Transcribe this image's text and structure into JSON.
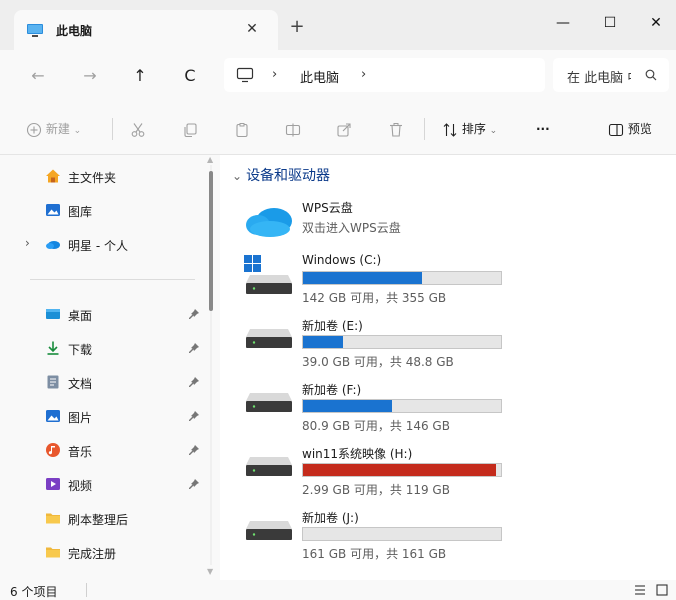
{
  "window": {
    "tab_title": "此电脑",
    "tab_close": "✕",
    "new_tab": "+",
    "minimize": "—",
    "maximize": "☐",
    "close": "✕"
  },
  "nav": {
    "back": "←",
    "forward": "→",
    "up": "↑",
    "refresh": "C",
    "separator": "›",
    "breadcrumb": "此电脑",
    "search_placeholder": "在 此电脑 中搜索"
  },
  "commandbar": {
    "new_label": "新建",
    "sort_label": "排序",
    "more_label": "···",
    "preview_label": "预览"
  },
  "sidebar": {
    "items": [
      {
        "label": "主文件夹",
        "icon": "home-icon"
      },
      {
        "label": "图库",
        "icon": "gallery-icon"
      },
      {
        "label": "明星 - 个人",
        "icon": "onedrive-cloud-icon"
      },
      {
        "label": "桌面",
        "icon": "desktop-icon",
        "pinned": true
      },
      {
        "label": "下载",
        "icon": "download-icon",
        "pinned": true
      },
      {
        "label": "文档",
        "icon": "document-icon",
        "pinned": true
      },
      {
        "label": "图片",
        "icon": "pictures-icon",
        "pinned": true
      },
      {
        "label": "音乐",
        "icon": "music-icon",
        "pinned": true
      },
      {
        "label": "视频",
        "icon": "video-icon",
        "pinned": true
      },
      {
        "label": "刷本整理后",
        "icon": "folder-icon"
      },
      {
        "label": "完成注册",
        "icon": "folder-icon"
      }
    ]
  },
  "content": {
    "group_header": "设备和驱动器",
    "wps": {
      "name": "WPS云盘",
      "subtitle": "双击进入WPS云盘"
    },
    "drives": [
      {
        "name": "Windows (C:)",
        "free": "142 GB 可用，共 355 GB",
        "used_fraction": 0.6,
        "color": "#1a73d0",
        "icon": "windows-drive-icon"
      },
      {
        "name": "新加卷 (E:)",
        "free": "39.0 GB 可用，共 48.8 GB",
        "used_fraction": 0.2,
        "color": "#1a73d0",
        "icon": "hard-drive-icon"
      },
      {
        "name": "新加卷 (F:)",
        "free": "80.9 GB 可用，共 146 GB",
        "used_fraction": 0.45,
        "color": "#1a73d0",
        "icon": "hard-drive-icon"
      },
      {
        "name": "win11系统映像 (H:)",
        "free": "2.99 GB 可用，共 119 GB",
        "used_fraction": 0.975,
        "color": "#c42b1c",
        "icon": "hard-drive-icon"
      },
      {
        "name": "新加卷 (J:)",
        "free": "161 GB 可用，共 161 GB",
        "used_fraction": 0.0,
        "color": "#1a73d0",
        "icon": "hard-drive-icon"
      }
    ]
  },
  "status": {
    "item_count": "6 个项目"
  }
}
